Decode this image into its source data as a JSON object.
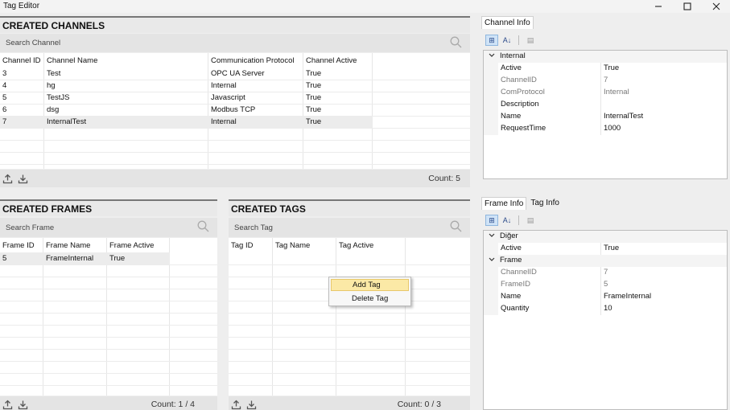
{
  "window": {
    "title": "Tag Editor"
  },
  "channels": {
    "header": "CREATED CHANNELS",
    "search_placeholder": "Search Channel",
    "columns": [
      "Channel ID",
      "Channel Name",
      "Communication Protocol",
      "Channel Active"
    ],
    "rows": [
      [
        "3",
        "Test",
        "OPC UA Server",
        "True"
      ],
      [
        "4",
        "hg",
        "Internal",
        "True"
      ],
      [
        "5",
        "TestJS",
        "Javascript",
        "True"
      ],
      [
        "6",
        "dsg",
        "Modbus TCP",
        "True"
      ],
      [
        "7",
        "InternalTest",
        "Internal",
        "True"
      ]
    ],
    "selected_row": 4,
    "count": "Count: 5"
  },
  "frames": {
    "header": "CREATED FRAMES",
    "search_placeholder": "Search Frame",
    "columns": [
      "Frame ID",
      "Frame Name",
      "Frame Active"
    ],
    "rows": [
      [
        "5",
        "FrameInternal",
        "True"
      ]
    ],
    "count": "Count: 1 / 4"
  },
  "tags": {
    "header": "CREATED TAGS",
    "search_placeholder": "Search Tag",
    "columns": [
      "Tag ID",
      "Tag Name",
      "Tag Active"
    ],
    "rows": [],
    "count": "Count: 0 / 3"
  },
  "context_menu": {
    "items": [
      "Add Tag",
      "Delete Tag"
    ],
    "highlighted": 0
  },
  "channel_info": {
    "tab": "Channel Info",
    "category": "Internal",
    "props": [
      {
        "name": "Active",
        "value": "True",
        "readonly": false
      },
      {
        "name": "ChannelID",
        "value": "7",
        "readonly": true
      },
      {
        "name": "ComProtocol",
        "value": "Internal",
        "readonly": true
      },
      {
        "name": "Description",
        "value": "",
        "readonly": false
      },
      {
        "name": "Name",
        "value": "InternalTest",
        "readonly": false
      },
      {
        "name": "RequestTime",
        "value": "1000",
        "readonly": false
      }
    ]
  },
  "frame_info": {
    "tabs": [
      "Frame Info",
      "Tag Info"
    ],
    "categories": [
      {
        "name": "Diğer",
        "props": [
          {
            "name": "Active",
            "value": "True",
            "readonly": false
          }
        ]
      },
      {
        "name": "Frame",
        "props": [
          {
            "name": "ChannelID",
            "value": "7",
            "readonly": true
          },
          {
            "name": "FrameID",
            "value": "5",
            "readonly": true
          },
          {
            "name": "Name",
            "value": "FrameInternal",
            "readonly": false
          },
          {
            "name": "Quantity",
            "value": "10",
            "readonly": false
          }
        ]
      }
    ]
  },
  "toolbar": {
    "categorized_glyph": "⊞",
    "alpha_glyph": "A↓",
    "pages_glyph": "▤"
  }
}
